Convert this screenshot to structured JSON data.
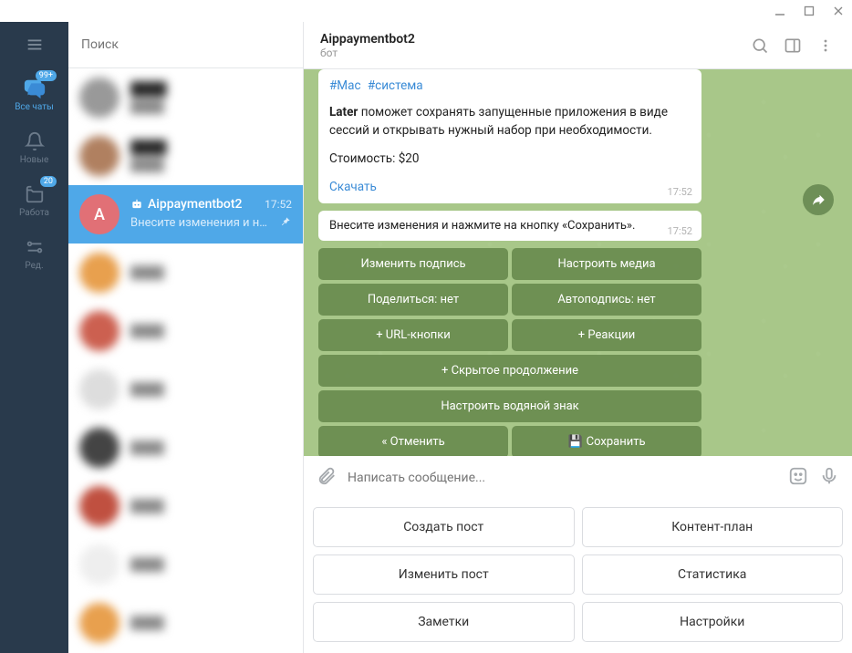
{
  "titlebar": {
    "min": "—",
    "max": "◻",
    "close": "✕"
  },
  "rail": {
    "tabs": [
      {
        "label": "Все чаты",
        "badge": "99+"
      },
      {
        "label": "Новые"
      },
      {
        "label": "Работа",
        "badge": "20"
      },
      {
        "label": "Ред."
      }
    ]
  },
  "search": {
    "placeholder": "Поиск"
  },
  "active_chat": {
    "avatar_letter": "A",
    "name": "Aippaymentbot2",
    "time": "17:52",
    "preview": "Внесите изменения и н…"
  },
  "header": {
    "title": "Aippaymentbot2",
    "subtitle": "бот"
  },
  "message": {
    "tag1": "#Mac",
    "tag2": "#система",
    "p1_bold": "Later",
    "p1_rest": " поможет сохранять запущенные приложения в виде сессий и открывать нужный набор при необходимости.",
    "p2": "Стоимость: $20",
    "link": "Скачать",
    "time": "17:52"
  },
  "prompt": {
    "text": "Внесите изменения и нажмите на кнопку «Сохранить».",
    "time": "17:52"
  },
  "keyboard": {
    "r1": [
      "Изменить подпись",
      "Настроить медиа"
    ],
    "r2": [
      "Поделиться: нет",
      "Автоподпись: нет"
    ],
    "r3": [
      "+ URL-кнопки",
      "+ Реакции"
    ],
    "r4": [
      "+ Скрытое продолжение"
    ],
    "r5": [
      "Настроить водяной знак"
    ],
    "r6": [
      "« Отменить",
      "Сохранить"
    ]
  },
  "input": {
    "placeholder": "Написать сообщение..."
  },
  "bottom": {
    "b1": "Создать пост",
    "b2": "Контент-план",
    "b3": "Изменить пост",
    "b4": "Статистика",
    "b5": "Заметки",
    "b6": "Настройки"
  }
}
